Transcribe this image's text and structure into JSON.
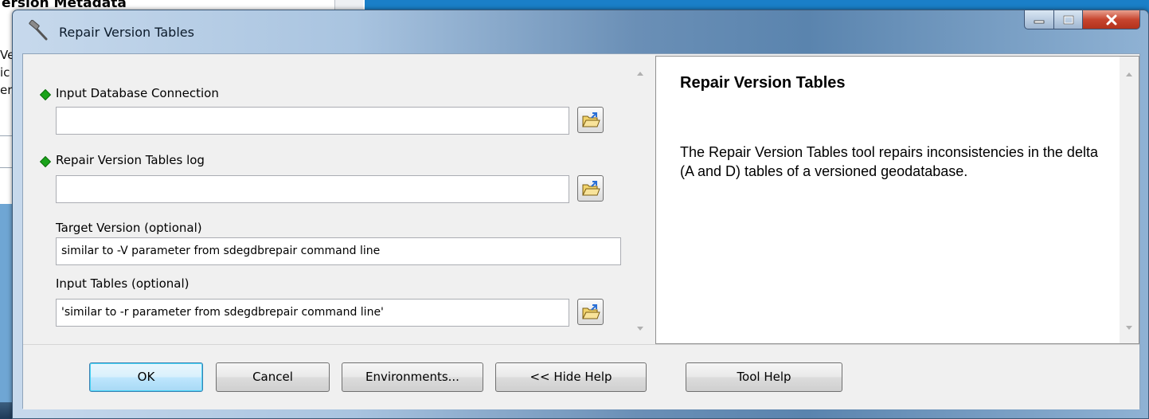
{
  "background_window": {
    "title_fragment": "ersion Metadata",
    "lines": [
      "Ve",
      "ic",
      "er"
    ]
  },
  "dialog": {
    "title": "Repair Version Tables",
    "window_buttons": {
      "minimize": "minimize",
      "maximize": "maximize",
      "close": "close"
    }
  },
  "params": [
    {
      "label": "Input Database Connection",
      "required": true,
      "value": "",
      "has_browse": true
    },
    {
      "label": "Repair Version Tables log",
      "required": true,
      "value": "",
      "has_browse": true
    },
    {
      "label": "Target Version (optional)",
      "required": false,
      "value": "similar to -V parameter from sdegdbrepair command line",
      "has_browse": false
    },
    {
      "label": "Input Tables (optional)",
      "required": false,
      "value": "'similar to -r parameter from sdegdbrepair command line'",
      "has_browse": true
    }
  ],
  "help": {
    "title": "Repair Version Tables",
    "body": "The Repair Version Tables tool repairs inconsistencies in the delta (A and D) tables of a versioned geodatabase."
  },
  "buttons": {
    "ok": "OK",
    "cancel": "Cancel",
    "environments": "Environments...",
    "hide_help": "<< Hide Help",
    "tool_help": "Tool Help"
  },
  "colors": {
    "required_indicator": "#1aa31a",
    "default_button": "#bee6fd",
    "close_button": "#c7452f"
  },
  "icons": [
    "hammer-icon",
    "folder-open-icon"
  ]
}
